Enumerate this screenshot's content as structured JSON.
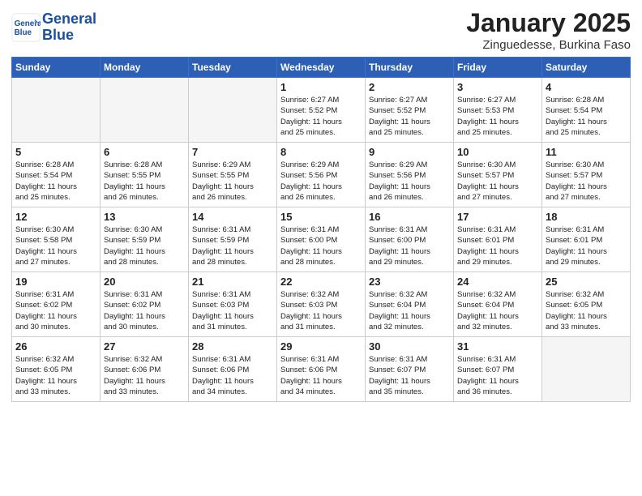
{
  "logo": {
    "line1": "General",
    "line2": "Blue"
  },
  "header": {
    "month": "January 2025",
    "location": "Zinguedesse, Burkina Faso"
  },
  "weekdays": [
    "Sunday",
    "Monday",
    "Tuesday",
    "Wednesday",
    "Thursday",
    "Friday",
    "Saturday"
  ],
  "weeks": [
    [
      {
        "day": "",
        "info": ""
      },
      {
        "day": "",
        "info": ""
      },
      {
        "day": "",
        "info": ""
      },
      {
        "day": "1",
        "info": "Sunrise: 6:27 AM\nSunset: 5:52 PM\nDaylight: 11 hours\nand 25 minutes."
      },
      {
        "day": "2",
        "info": "Sunrise: 6:27 AM\nSunset: 5:52 PM\nDaylight: 11 hours\nand 25 minutes."
      },
      {
        "day": "3",
        "info": "Sunrise: 6:27 AM\nSunset: 5:53 PM\nDaylight: 11 hours\nand 25 minutes."
      },
      {
        "day": "4",
        "info": "Sunrise: 6:28 AM\nSunset: 5:54 PM\nDaylight: 11 hours\nand 25 minutes."
      }
    ],
    [
      {
        "day": "5",
        "info": "Sunrise: 6:28 AM\nSunset: 5:54 PM\nDaylight: 11 hours\nand 25 minutes."
      },
      {
        "day": "6",
        "info": "Sunrise: 6:28 AM\nSunset: 5:55 PM\nDaylight: 11 hours\nand 26 minutes."
      },
      {
        "day": "7",
        "info": "Sunrise: 6:29 AM\nSunset: 5:55 PM\nDaylight: 11 hours\nand 26 minutes."
      },
      {
        "day": "8",
        "info": "Sunrise: 6:29 AM\nSunset: 5:56 PM\nDaylight: 11 hours\nand 26 minutes."
      },
      {
        "day": "9",
        "info": "Sunrise: 6:29 AM\nSunset: 5:56 PM\nDaylight: 11 hours\nand 26 minutes."
      },
      {
        "day": "10",
        "info": "Sunrise: 6:30 AM\nSunset: 5:57 PM\nDaylight: 11 hours\nand 27 minutes."
      },
      {
        "day": "11",
        "info": "Sunrise: 6:30 AM\nSunset: 5:57 PM\nDaylight: 11 hours\nand 27 minutes."
      }
    ],
    [
      {
        "day": "12",
        "info": "Sunrise: 6:30 AM\nSunset: 5:58 PM\nDaylight: 11 hours\nand 27 minutes."
      },
      {
        "day": "13",
        "info": "Sunrise: 6:30 AM\nSunset: 5:59 PM\nDaylight: 11 hours\nand 28 minutes."
      },
      {
        "day": "14",
        "info": "Sunrise: 6:31 AM\nSunset: 5:59 PM\nDaylight: 11 hours\nand 28 minutes."
      },
      {
        "day": "15",
        "info": "Sunrise: 6:31 AM\nSunset: 6:00 PM\nDaylight: 11 hours\nand 28 minutes."
      },
      {
        "day": "16",
        "info": "Sunrise: 6:31 AM\nSunset: 6:00 PM\nDaylight: 11 hours\nand 29 minutes."
      },
      {
        "day": "17",
        "info": "Sunrise: 6:31 AM\nSunset: 6:01 PM\nDaylight: 11 hours\nand 29 minutes."
      },
      {
        "day": "18",
        "info": "Sunrise: 6:31 AM\nSunset: 6:01 PM\nDaylight: 11 hours\nand 29 minutes."
      }
    ],
    [
      {
        "day": "19",
        "info": "Sunrise: 6:31 AM\nSunset: 6:02 PM\nDaylight: 11 hours\nand 30 minutes."
      },
      {
        "day": "20",
        "info": "Sunrise: 6:31 AM\nSunset: 6:02 PM\nDaylight: 11 hours\nand 30 minutes."
      },
      {
        "day": "21",
        "info": "Sunrise: 6:31 AM\nSunset: 6:03 PM\nDaylight: 11 hours\nand 31 minutes."
      },
      {
        "day": "22",
        "info": "Sunrise: 6:32 AM\nSunset: 6:03 PM\nDaylight: 11 hours\nand 31 minutes."
      },
      {
        "day": "23",
        "info": "Sunrise: 6:32 AM\nSunset: 6:04 PM\nDaylight: 11 hours\nand 32 minutes."
      },
      {
        "day": "24",
        "info": "Sunrise: 6:32 AM\nSunset: 6:04 PM\nDaylight: 11 hours\nand 32 minutes."
      },
      {
        "day": "25",
        "info": "Sunrise: 6:32 AM\nSunset: 6:05 PM\nDaylight: 11 hours\nand 33 minutes."
      }
    ],
    [
      {
        "day": "26",
        "info": "Sunrise: 6:32 AM\nSunset: 6:05 PM\nDaylight: 11 hours\nand 33 minutes."
      },
      {
        "day": "27",
        "info": "Sunrise: 6:32 AM\nSunset: 6:06 PM\nDaylight: 11 hours\nand 33 minutes."
      },
      {
        "day": "28",
        "info": "Sunrise: 6:31 AM\nSunset: 6:06 PM\nDaylight: 11 hours\nand 34 minutes."
      },
      {
        "day": "29",
        "info": "Sunrise: 6:31 AM\nSunset: 6:06 PM\nDaylight: 11 hours\nand 34 minutes."
      },
      {
        "day": "30",
        "info": "Sunrise: 6:31 AM\nSunset: 6:07 PM\nDaylight: 11 hours\nand 35 minutes."
      },
      {
        "day": "31",
        "info": "Sunrise: 6:31 AM\nSunset: 6:07 PM\nDaylight: 11 hours\nand 36 minutes."
      },
      {
        "day": "",
        "info": ""
      }
    ]
  ]
}
